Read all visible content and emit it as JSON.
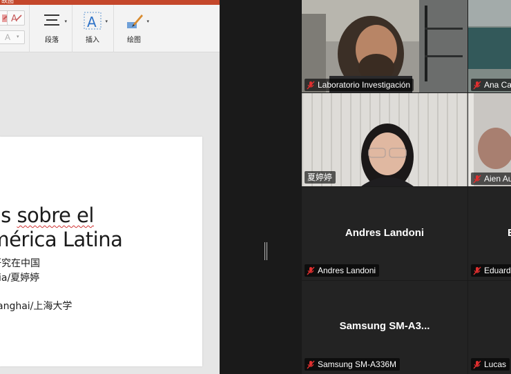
{
  "app": {
    "title_fragment": "故图",
    "ribbon": {
      "small_icon_label": "A",
      "buttons": [
        {
          "label": "段落",
          "icon": "paragraph-icon"
        },
        {
          "label": "插入",
          "icon": "insert-text-icon"
        },
        {
          "label": "绘图",
          "icon": "drawing-icon"
        }
      ]
    },
    "slide": {
      "title_line1_a": "nos ",
      "title_line1_b": "sobre el",
      "title_line2": "América Latina",
      "subtitle_line1": "研究在中国",
      "subtitle_line2": "ia/夏婷婷",
      "subtitle_line3": "anghai/上海大学"
    }
  },
  "meeting": {
    "participants": [
      {
        "name": "Laboratorio Investigación",
        "video": true,
        "muted": true
      },
      {
        "name": "Ana Ca",
        "video": true,
        "muted": true
      },
      {
        "name": "夏婷婷",
        "video": true,
        "muted": false,
        "active_speaker": true
      },
      {
        "name": "Aien Au",
        "video": true,
        "muted": true
      },
      {
        "name": "Andres Landoni",
        "display_name": "Andres Landoni",
        "video": false,
        "muted": true
      },
      {
        "name": "Eduard",
        "display_name": "E",
        "video": false,
        "muted": true
      },
      {
        "name": "Samsung SM-A336M",
        "display_name": "Samsung  SM-A3...",
        "video": false,
        "muted": true
      },
      {
        "name": "Lucas",
        "video": false,
        "muted": true
      }
    ],
    "colors": {
      "active_border": "#2fc46a",
      "mic_off": "#e02f2f",
      "tile_bg": "#232323"
    }
  }
}
